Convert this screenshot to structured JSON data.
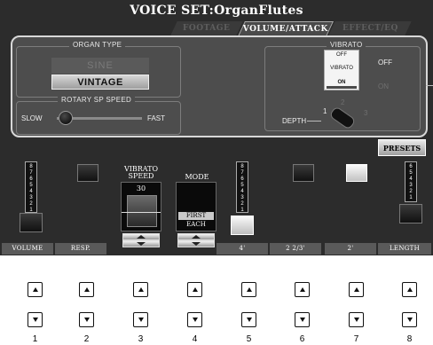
{
  "header": {
    "title": "VOICE SET:OrganFlutes"
  },
  "tabs": [
    {
      "label": "FOOTAGE",
      "active": false
    },
    {
      "label": "VOLUME/ATTACK",
      "active": true
    },
    {
      "label": "EFFECT/EQ",
      "active": false
    }
  ],
  "organ_type": {
    "label": "ORGAN TYPE",
    "options": [
      "SINE",
      "VINTAGE"
    ],
    "selected": "VINTAGE"
  },
  "rotary": {
    "label": "ROTARY SP SPEED",
    "slow": "SLOW",
    "fast": "FAST",
    "position": "SLOW"
  },
  "vibrato": {
    "label": "VIBRATO",
    "switch_off": "OFF",
    "switch_mid": "VIBRATO",
    "switch_on": "ON",
    "side_off": "OFF",
    "side_on": "ON",
    "state": "ON",
    "depth_label": "DEPTH",
    "depth_marks": [
      "1",
      "2",
      "3"
    ],
    "depth_value": 1
  },
  "presets_label": "PRESETS",
  "vibrato_speed": {
    "label_line1": "VIBRATO",
    "label_line2": "SPEED",
    "value": "30"
  },
  "mode": {
    "label": "MODE",
    "first": "FIRST",
    "each": "EACH",
    "selected": "FIRST"
  },
  "scale_numbers": [
    "8",
    "7",
    "6",
    "5",
    "4",
    "3",
    "2",
    "1"
  ],
  "length_numbers": [
    "6",
    "5",
    "4",
    "3",
    "2",
    "1"
  ],
  "strip_labels": [
    "VOLUME",
    "RESP.",
    "",
    "",
    "4'",
    "2 2/3'",
    "2'",
    "LENGTH"
  ],
  "hw_buttons": [
    "1",
    "2",
    "3",
    "4",
    "5",
    "6",
    "7",
    "8"
  ],
  "colors": {
    "screen_bg": "#2c2c2c",
    "panel_bg": "#4d4d4d",
    "panel_border": "#d8d8d8",
    "highlight": "#c9c9c9"
  }
}
